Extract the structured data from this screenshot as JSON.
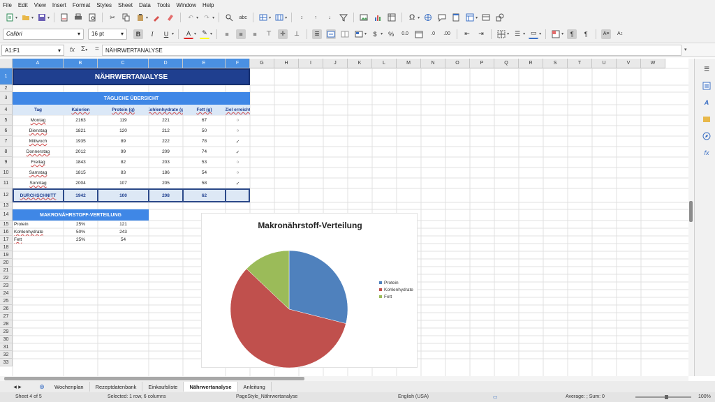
{
  "menu": [
    "File",
    "Edit",
    "View",
    "Insert",
    "Format",
    "Styles",
    "Sheet",
    "Data",
    "Tools",
    "Window",
    "Help"
  ],
  "toolbar": {
    "font_name": "Calibri",
    "font_size": "16 pt"
  },
  "formula_bar": {
    "name_box": "A1:F1",
    "content": "NÄHRWERTANALYSE"
  },
  "columns": [
    "A",
    "B",
    "C",
    "D",
    "E",
    "F",
    "G",
    "H",
    "I",
    "J",
    "K",
    "L",
    "M",
    "N",
    "O",
    "P",
    "Q",
    "R",
    "S",
    "T",
    "U",
    "V",
    "W"
  ],
  "rows": [
    "1",
    "2",
    "3",
    "4",
    "5",
    "6",
    "7",
    "8",
    "9",
    "10",
    "11",
    "12",
    "13",
    "14",
    "15",
    "16",
    "17",
    "18",
    "19",
    "20",
    "21",
    "22",
    "23",
    "24",
    "25",
    "26",
    "27",
    "28",
    "29",
    "30",
    "31",
    "32",
    "33"
  ],
  "sheet": {
    "title": "NÄHRWERTANALYSE",
    "daily_section": "TÄGLICHE ÜBERSICHT",
    "headers": [
      "Tag",
      "Kalorien",
      "Protein (g)",
      "Kohlenhydrate (g)",
      "Fett (g)",
      "Ziel erreicht"
    ],
    "days": [
      [
        "Montag",
        "2163",
        "119",
        "221",
        "67",
        "○"
      ],
      [
        "Dienstag",
        "1821",
        "120",
        "212",
        "50",
        "○"
      ],
      [
        "Mittwoch",
        "1935",
        "89",
        "222",
        "78",
        "✓"
      ],
      [
        "Donnerstag",
        "2012",
        "99",
        "209",
        "74",
        "✓"
      ],
      [
        "Freitag",
        "1843",
        "82",
        "203",
        "53",
        "○"
      ],
      [
        "Samstag",
        "1815",
        "83",
        "186",
        "54",
        "○"
      ],
      [
        "Sonntag",
        "2004",
        "107",
        "205",
        "58",
        "✓"
      ]
    ],
    "average": [
      "DURCHSCHNITT",
      "1942",
      "100",
      "208",
      "62",
      ""
    ],
    "macro_section": "MAKRONÄHRSTOFF-VERTEILUNG",
    "macros": [
      [
        "Protein",
        "25%",
        "121"
      ],
      [
        "Kohlenhydrate",
        "50%",
        "243"
      ],
      [
        "Fett",
        "25%",
        "54"
      ]
    ]
  },
  "chart_data": {
    "type": "pie",
    "title": "Makronährstoff-Verteilung",
    "categories": [
      "Protein",
      "Kohlenhydrate",
      "Fett"
    ],
    "values": [
      121,
      243,
      54
    ],
    "colors": [
      "#4f81bd",
      "#c0504d",
      "#9bbb59"
    ],
    "legend": "right"
  },
  "tabs": [
    "Wochenplan",
    "Rezeptdatenbank",
    "Einkaufsliste",
    "Nährwertanalyse",
    "Anleitung"
  ],
  "active_tab": "Nährwertanalyse",
  "status": {
    "sheet": "Sheet 4 of 5",
    "selection": "Selected: 1 row, 6 columns",
    "page_style": "PageStyle_Nährwertanalyse",
    "language": "English (USA)",
    "summary": "Average: ; Sum: 0",
    "zoom": "100%"
  }
}
